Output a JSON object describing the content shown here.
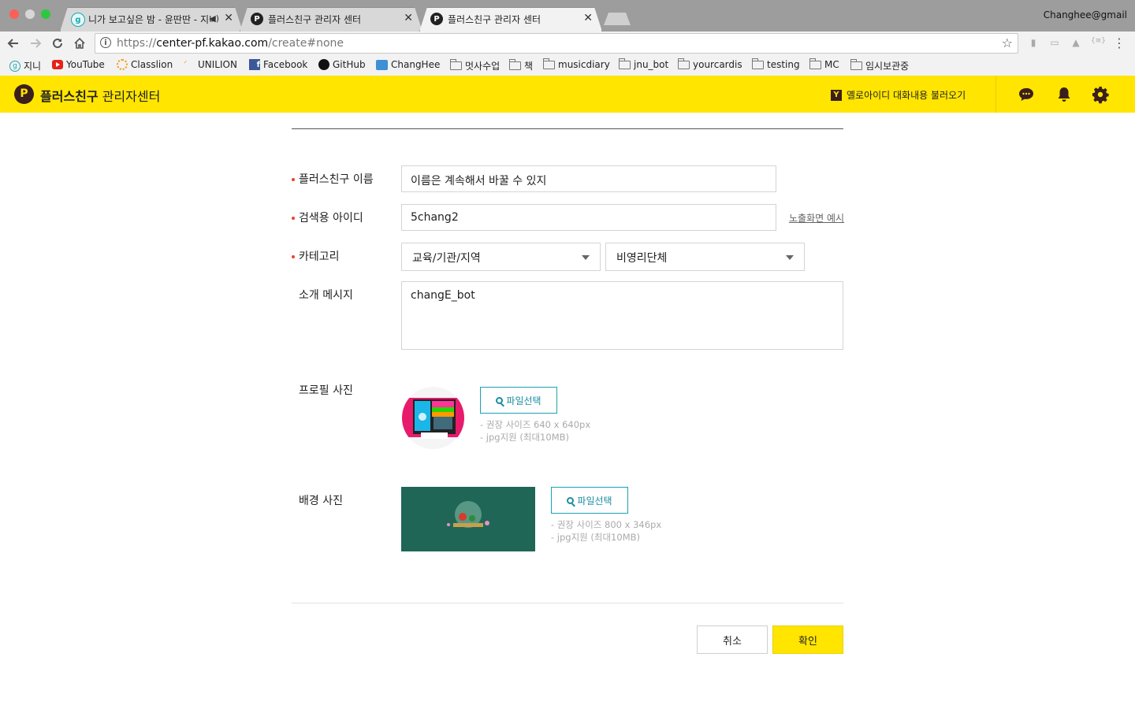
{
  "browser": {
    "tabs": [
      {
        "title": "니가 보고싶은 밤 - 윤딴딴 - 지니",
        "favicon": "g"
      },
      {
        "title": "플러스친구 관리자 센터",
        "favicon": "P"
      },
      {
        "title": "플러스친구 관리자 센터",
        "favicon": "P"
      }
    ],
    "profile": "Changhee@gmail",
    "url_scheme": "https://",
    "url_host": "center-pf.kakao.com",
    "url_path": "/create#none",
    "bookmarks": [
      {
        "label": "지니",
        "icon": "genie-icon"
      },
      {
        "label": "YouTube",
        "icon": "youtube-icon"
      },
      {
        "label": "Classlion",
        "icon": "classlion-icon"
      },
      {
        "label": "UNILION",
        "icon": "unilion-icon"
      },
      {
        "label": "Facebook",
        "icon": "facebook-icon"
      },
      {
        "label": "GitHub",
        "icon": "github-icon"
      },
      {
        "label": "ChangHee",
        "icon": "cloud-icon"
      },
      {
        "label": "멋사수업",
        "icon": "folder-icon"
      },
      {
        "label": "책",
        "icon": "folder-icon"
      },
      {
        "label": "musicdiary",
        "icon": "folder-icon"
      },
      {
        "label": "jnu_bot",
        "icon": "folder-icon"
      },
      {
        "label": "yourcardis",
        "icon": "folder-icon"
      },
      {
        "label": "testing",
        "icon": "folder-icon"
      },
      {
        "label": "MC",
        "icon": "folder-icon"
      },
      {
        "label": "임시보관중",
        "icon": "folder-icon"
      }
    ]
  },
  "header": {
    "logo_letter": "P",
    "brand_bold": "플러스친구",
    "brand_rest": "관리자센터",
    "yellowid_badge": "Y",
    "yellowid_label": "옐로아이디 대화내용 불러오기",
    "colors": {
      "accent": "#ffe500",
      "logo": "#3b1e1e"
    }
  },
  "form": {
    "name": {
      "label": "플러스친구 이름",
      "value": "이름은 계속해서 바꿀 수 있지"
    },
    "search_id": {
      "label": "검색용 아이디",
      "value": "5chang2",
      "preview_link": "노출화면 예시"
    },
    "category": {
      "label": "카테고리",
      "primary": "교육/기관/지역",
      "secondary": "비영리단체"
    },
    "intro": {
      "label": "소개 메시지",
      "value": "changE_bot"
    },
    "profile_photo": {
      "label": "프로필 사진",
      "button": "파일선택",
      "hint_size": "- 권장 사이즈 640 x 640px",
      "hint_type": "- jpg지원 (최대10MB)"
    },
    "bg_photo": {
      "label": "배경 사진",
      "button": "파일선택",
      "hint_size": "- 권장 사이즈 800 x 346px",
      "hint_type": "- jpg지원 (최대10MB)"
    },
    "cancel": "취소",
    "confirm": "확인"
  }
}
